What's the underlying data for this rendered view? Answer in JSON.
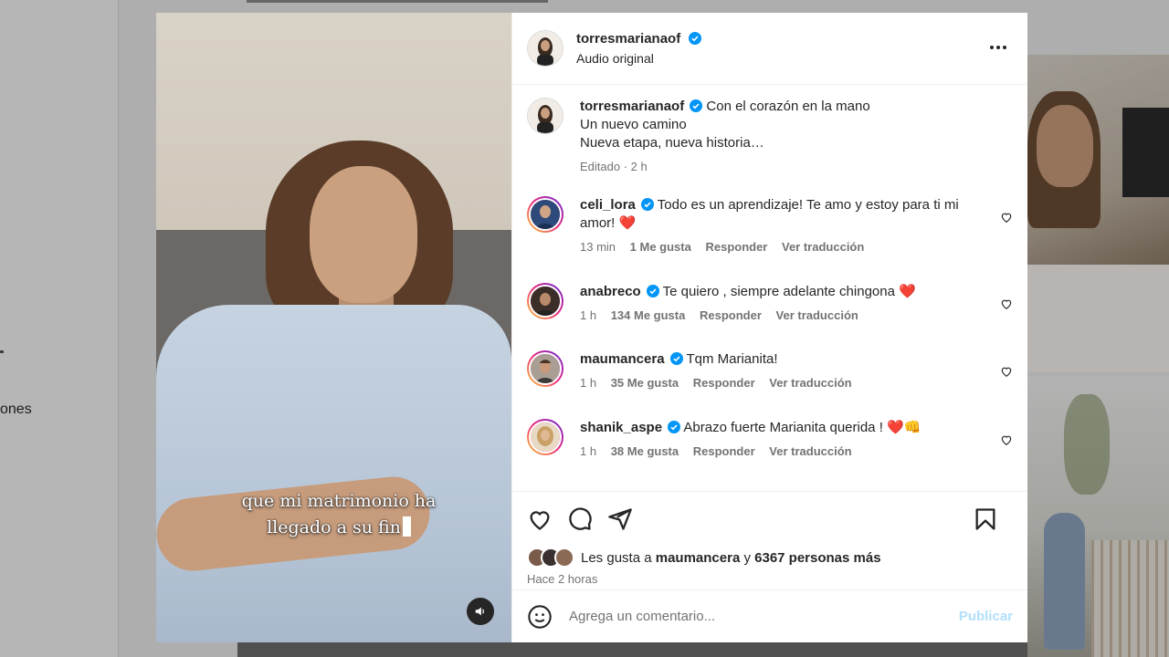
{
  "background": {
    "nav_label": "ones"
  },
  "post": {
    "username": "torresmarianaof",
    "audio": "Audio original",
    "video_caption_line1": "que mi matrimonio ha",
    "video_caption_line2": "llegado a su fin"
  },
  "caption": {
    "username": "torresmarianaof",
    "line1": "Con el corazón en la mano",
    "line2": "Un nuevo camino",
    "line3": "Nueva etapa, nueva historia…",
    "meta": "Editado · 2 h"
  },
  "comments": [
    {
      "username": "celi_lora",
      "text": "Todo es un aprendizaje! Te amo y estoy para ti mi amor! ❤️",
      "time": "13 min",
      "likes": "1 Me gusta",
      "reply": "Responder",
      "translate": "Ver traducción"
    },
    {
      "username": "anabreco",
      "text": "Te quiero , siempre adelante chingona ❤️",
      "time": "1 h",
      "likes": "134 Me gusta",
      "reply": "Responder",
      "translate": "Ver traducción"
    },
    {
      "username": "maumancera",
      "text": "Tqm Marianita!",
      "time": "1 h",
      "likes": "35 Me gusta",
      "reply": "Responder",
      "translate": "Ver traducción"
    },
    {
      "username": "shanik_aspe",
      "text": "Abrazo fuerte Marianita querida ! ❤️👊",
      "time": "1 h",
      "likes": "38 Me gusta",
      "reply": "Responder",
      "translate": "Ver traducción"
    }
  ],
  "likes_summary": {
    "prefix": "Les gusta a",
    "user": "maumancera",
    "connector": "y",
    "others": "6367 personas más"
  },
  "posted_ago": "Hace 2 horas",
  "comment_box": {
    "placeholder": "Agrega un comentario...",
    "publish_label": "Publicar"
  },
  "colors": {
    "verified": "#0095f6",
    "heart": "#ed1c24",
    "publish_disabled": "#b2dffc"
  },
  "icons": [
    "verified-badge-icon",
    "more-options-icon",
    "heart-icon",
    "comment-icon",
    "share-icon",
    "bookmark-icon",
    "emoji-icon",
    "sound-icon"
  ]
}
